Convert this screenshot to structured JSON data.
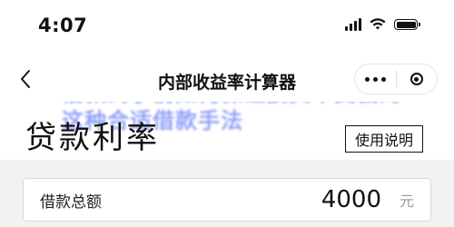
{
  "status_bar": {
    "time": "4:07"
  },
  "nav": {
    "title": "内部收益率计算器"
  },
  "banner": {
    "text": "借款到手前如何保证投资不受骗的这种合适借款手法"
  },
  "page": {
    "heading": "贷款利率",
    "help_label": "使用说明"
  },
  "loan_amount": {
    "label": "借款总额",
    "value": "4000",
    "unit": "元"
  },
  "colors": {
    "accent": "#3b57f5",
    "background": "#f2f2f3"
  }
}
